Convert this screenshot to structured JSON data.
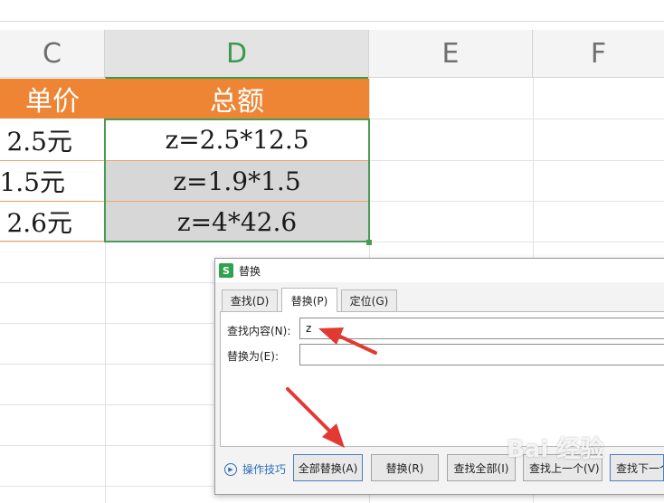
{
  "columns": [
    "C",
    "D",
    "E",
    "F"
  ],
  "header_row": {
    "c": "单价",
    "d": "总额"
  },
  "rows": [
    {
      "c": "2.5元",
      "d": "z=2.5*12.5"
    },
    {
      "c": "1.5元",
      "d": "z=1.9*1.5"
    },
    {
      "c": "2.6元",
      "d": "z=4*42.6"
    }
  ],
  "dialog": {
    "title": "替换",
    "tabs": [
      "查找(D)",
      "替换(P)",
      "定位(G)"
    ],
    "find_label": "查找内容(N):",
    "find_value": "z",
    "replace_label": "替换为(E):",
    "replace_value": "",
    "tips": "操作技巧",
    "buttons": [
      "全部替换(A)",
      "替换(R)",
      "查找全部(I)",
      "查找上一个(V)",
      "查找下一个(F)"
    ]
  },
  "watermark": "Bai 经验",
  "colors": {
    "header_orange": "#ee8535",
    "selection_green": "#4a9b55",
    "arrow_red": "#e23a32"
  }
}
